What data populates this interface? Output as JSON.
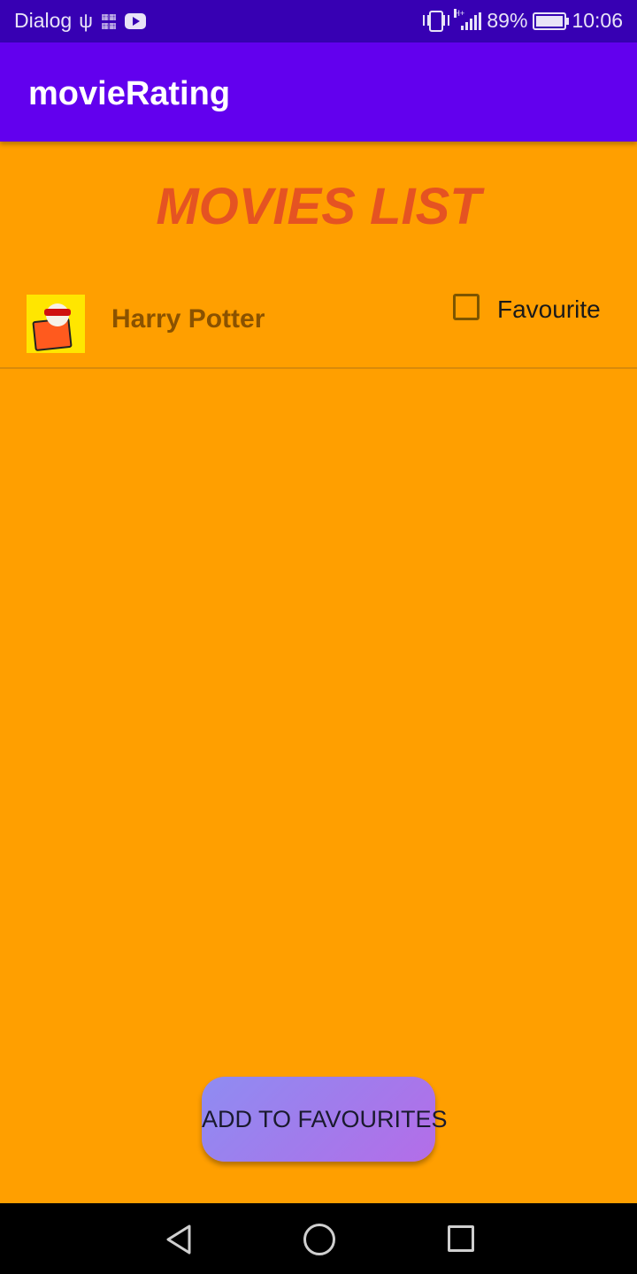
{
  "status_bar": {
    "carrier": "Dialog",
    "battery_percent": "89%",
    "time": "10:06",
    "icons": [
      "usb-icon",
      "sim-icon",
      "youtube-icon",
      "vibrate-icon",
      "signal-icon",
      "battery-icon"
    ]
  },
  "app_bar": {
    "title": "movieRating",
    "color": "#6200ee"
  },
  "main": {
    "heading": "MOVIES LIST",
    "heading_color": "#e55322",
    "background_color": "#ff9f00",
    "movies": [
      {
        "title": "Harry Potter",
        "favourite_label": "Favourite",
        "favourite_checked": false
      }
    ]
  },
  "actions": {
    "add_to_favourites_label": "ADD TO FAVOURITES"
  },
  "nav_bar": {
    "icons": [
      "back-icon",
      "home-icon",
      "recent-apps-icon"
    ]
  }
}
